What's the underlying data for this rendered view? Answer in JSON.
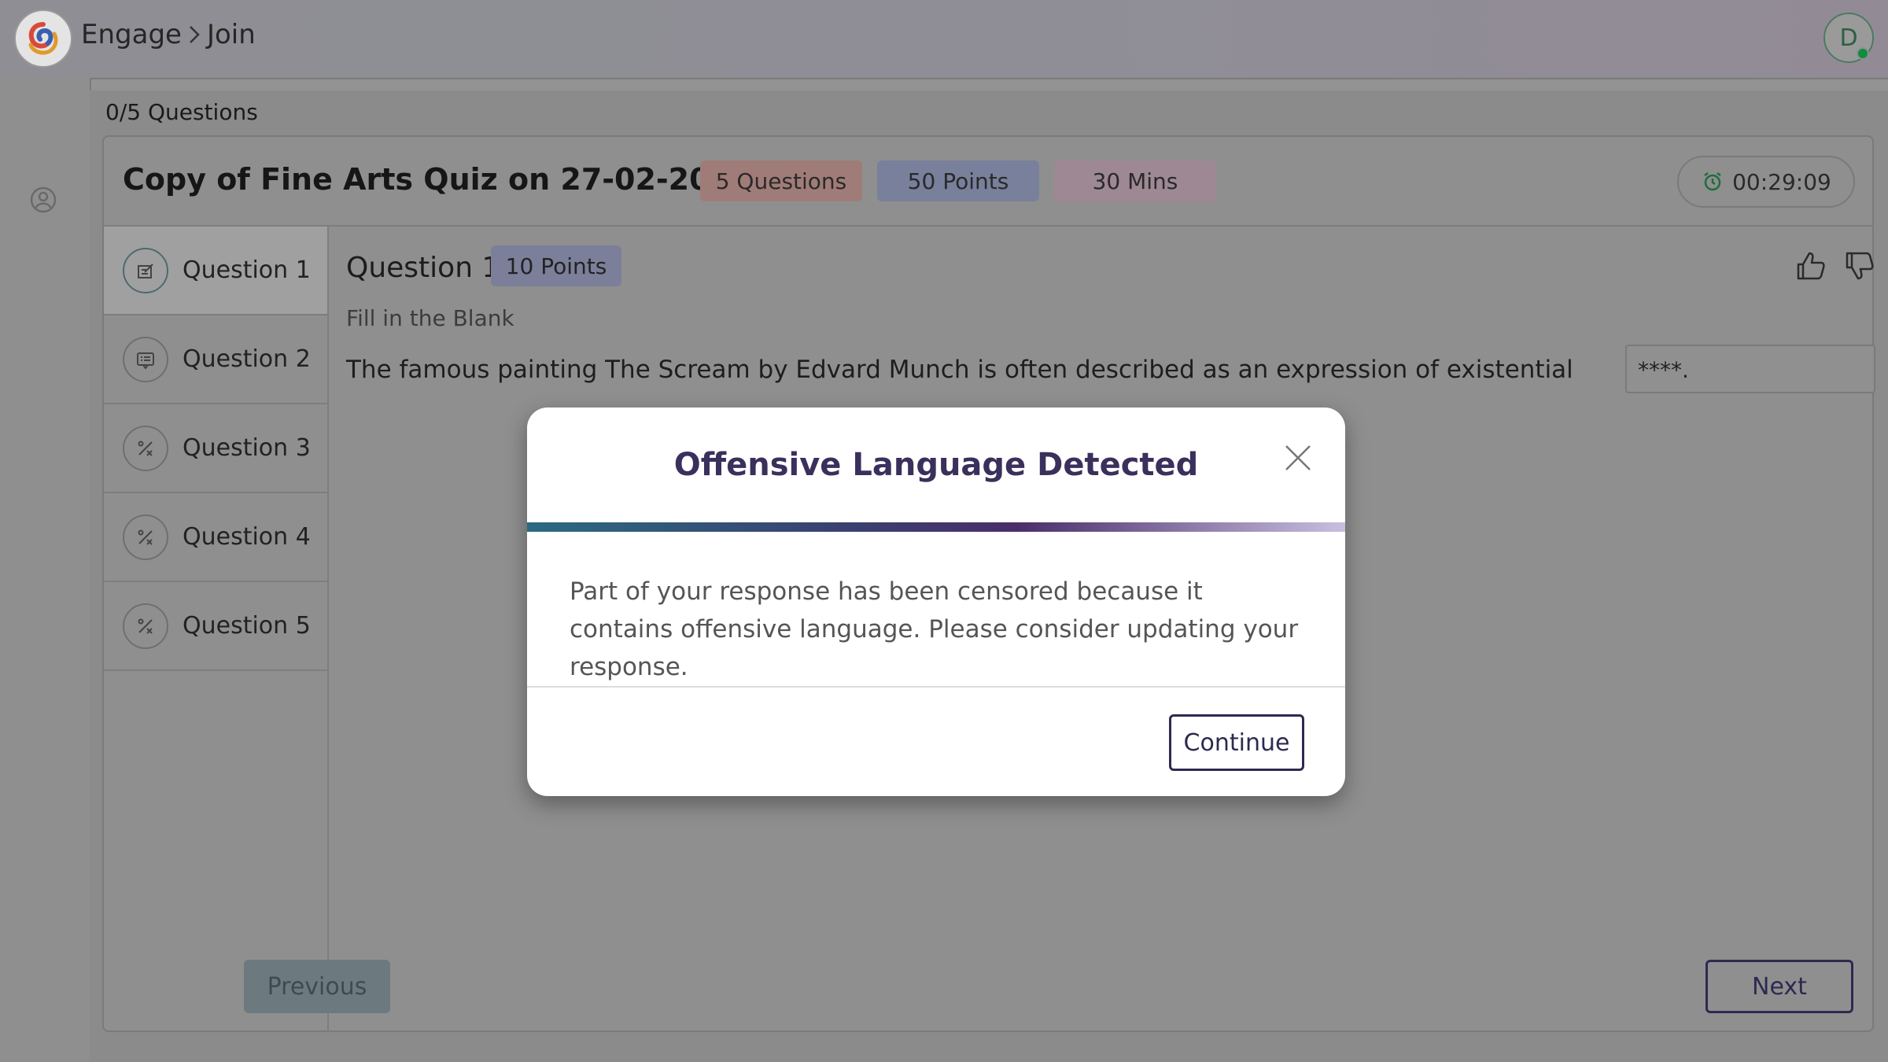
{
  "topbar": {
    "breadcrumb": [
      "Engage",
      "Join"
    ],
    "user_initial": "D"
  },
  "progress": {
    "label": "0/5 Questions",
    "answered": 0,
    "total": 5
  },
  "quiz": {
    "title": "Copy of Fine Arts Quiz on 27-02-2025",
    "pills": {
      "questions": "5 Questions",
      "points": "50 Points",
      "duration": "30 Mins"
    },
    "timer": "00:29:09"
  },
  "questions": [
    {
      "label": "Question 1",
      "icon": "edit-note-icon",
      "active": true
    },
    {
      "label": "Question 2",
      "icon": "list-card-icon",
      "active": false
    },
    {
      "label": "Question 3",
      "icon": "percent-icon",
      "active": false
    },
    {
      "label": "Question 4",
      "icon": "percent-icon",
      "active": false
    },
    {
      "label": "Question 5",
      "icon": "percent-icon",
      "active": false
    }
  ],
  "current_question": {
    "title": "Question 1",
    "points": "10 Points",
    "type": "Fill in the Blank",
    "text": "The famous painting The Scream by Edvard Munch is often described as an expression of existential",
    "blank_value": "****."
  },
  "nav": {
    "previous": "Previous",
    "next": "Next"
  },
  "modal": {
    "title": "Offensive Language Detected",
    "body": "Part of your response has been censored because it contains offensive language. Please consider updating your response.",
    "continue": "Continue"
  },
  "colors": {
    "modal_title": "#3b2f5c",
    "accent_dark": "#2d2a50",
    "online": "#0e8f3a"
  }
}
